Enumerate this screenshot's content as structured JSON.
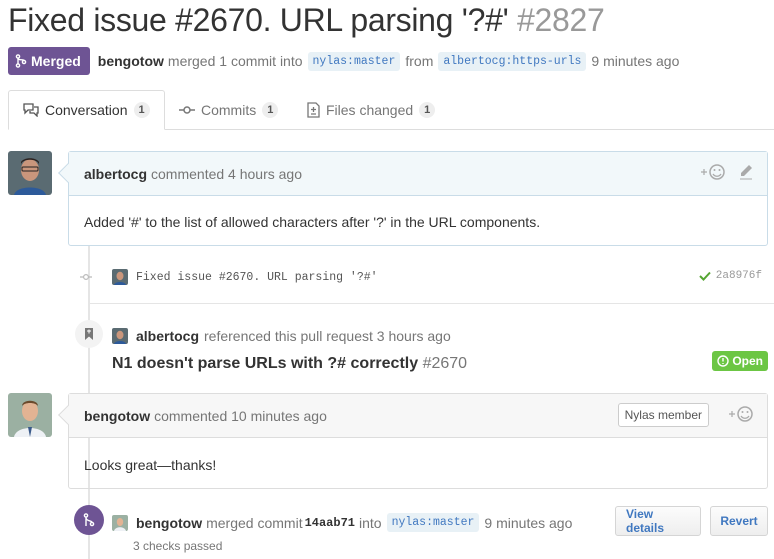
{
  "title": {
    "text": "Fixed issue #2670. URL parsing '?#'",
    "number": "#2827"
  },
  "meta": {
    "badge": "Merged",
    "user": "bengotow",
    "action": "merged 1 commit into",
    "base_owner": "nylas",
    "base_branch": "master",
    "from": "from",
    "head_owner": "albertocg",
    "head_branch": "https-urls",
    "time": "9 minutes ago"
  },
  "tabs": [
    {
      "label": "Conversation",
      "count": "1",
      "icon": "comment-discussion-icon"
    },
    {
      "label": "Commits",
      "count": "1",
      "icon": "git-commit-icon"
    },
    {
      "label": "Files changed",
      "count": "1",
      "icon": "diff-icon"
    }
  ],
  "comments": [
    {
      "author": "albertocg",
      "action": "commented 4 hours ago",
      "body": "Added '#' to the list of allowed characters after '?' in the URL components."
    },
    {
      "author": "bengotow",
      "action": "commented 10 minutes ago",
      "badge": "Nylas member",
      "body": "Looks great—thanks!"
    }
  ],
  "commit": {
    "message": "Fixed issue #2670. URL parsing '?#'",
    "sha": "2a8976f"
  },
  "reference": {
    "author": "albertocg",
    "action": "referenced this pull request 3 hours ago",
    "issue_title": "N1 doesn't parse URLs with ?# correctly",
    "issue_number": "#2670",
    "state": "Open"
  },
  "merge_event": {
    "author": "bengotow",
    "action": "merged commit",
    "sha": "14aab71",
    "into": "into",
    "base_owner": "nylas",
    "base_branch": "master",
    "time": "9 minutes ago",
    "checks": "3 checks passed",
    "view_details": "View details",
    "revert": "Revert"
  },
  "colors": {
    "merged": "#6e5494",
    "open": "#6cc644",
    "link": "#4078c0"
  }
}
